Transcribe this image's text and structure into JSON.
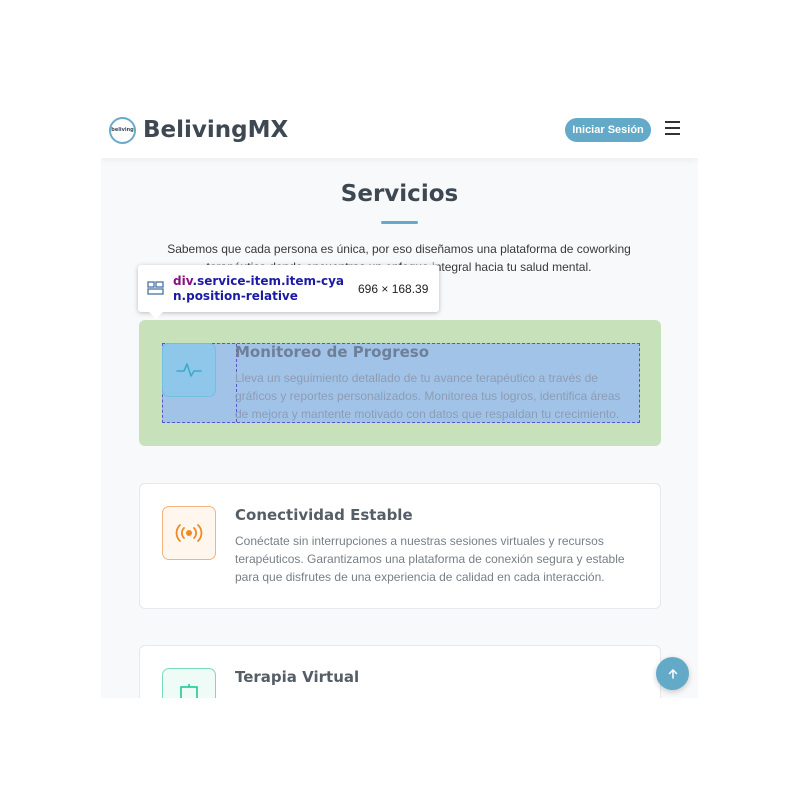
{
  "navbar": {
    "logo_text": "beliving",
    "brand_name": "BelivingMX",
    "login_label": "Iniciar Sesión"
  },
  "section": {
    "title": "Servicios",
    "description": "Sabemos que cada persona es única, por eso diseñamos una plataforma de coworking terapéutico donde encuentras un enfoque integral hacia tu salud mental."
  },
  "services": [
    {
      "title": "Monitoreo de Progreso",
      "text": "Lleva un seguimiento detallado de tu avance terapéutico a través de gráficos y reportes personalizados. Monitorea tus logros, identifica áreas de mejora y mantente motivado con datos que respaldan tu crecimiento.",
      "icon": "activity-icon",
      "color": "#3fa9c9"
    },
    {
      "title": "Conectividad Estable",
      "text": "Conéctate sin interrupciones a nuestras sesiones virtuales y recursos terapéuticos. Garantizamos una plataforma de conexión segura y estable para que disfrutes de una experiencia de calidad en cada interacción.",
      "icon": "broadcast-icon",
      "color": "#f08a24"
    },
    {
      "title": "Terapia Virtual",
      "text": "",
      "icon": "easel-icon",
      "color": "#20c997"
    }
  ],
  "devtools_tooltip": {
    "selector_tag": "div",
    "selector_classes": ".service-item.item-cyan.position-relative",
    "size": "696 × 168.39"
  },
  "colors": {
    "primary": "#63a9c8",
    "highlight_margin": "#c7e1bb",
    "highlight_content": "#a1c3e8"
  }
}
